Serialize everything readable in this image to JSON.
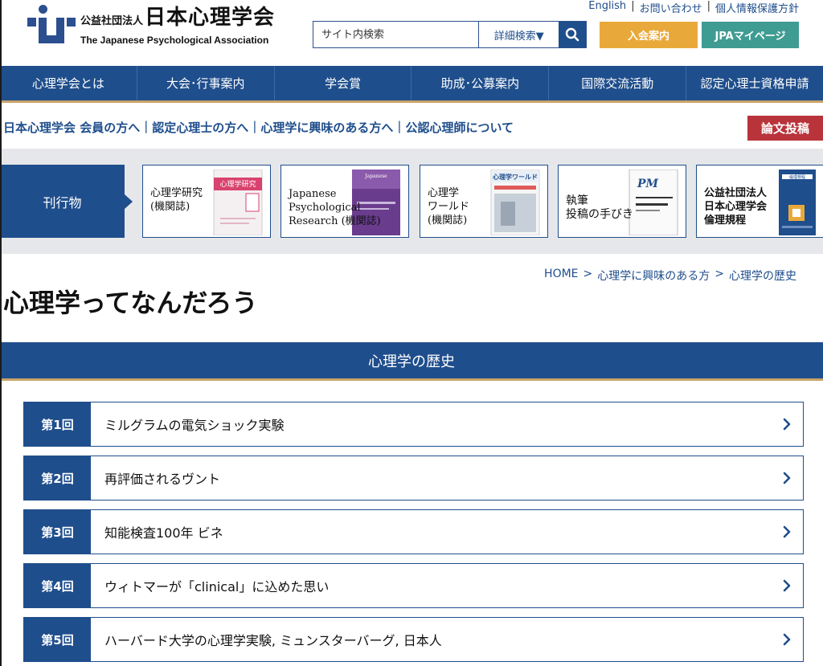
{
  "header": {
    "logo": {
      "jp_small": "公益社団法人",
      "jp_big": "日本心理学会",
      "en": "The Japanese Psychological Association"
    },
    "toplinks": [
      "English",
      "お問い合わせ",
      "個人情報保護方針"
    ],
    "search": {
      "placeholder": "サイト内検索",
      "advanced_label": "詳細検索▼"
    },
    "join_label": "入会案内",
    "mypage_label": "JPAマイページ"
  },
  "nav": {
    "items": [
      "心理学会とは",
      "大会･行事案内",
      "学会賞",
      "助成･公募案内",
      "国際交流活動",
      "認定心理士資格申請"
    ]
  },
  "audience": {
    "links": [
      "日本心理学会 会員の方へ",
      "認定心理士の方へ",
      "心理学に興味のある方へ",
      "公認心理師について"
    ],
    "submit_label": "論文投稿"
  },
  "publications": {
    "label": "刊行物",
    "cards": [
      {
        "text": "心理学研究\n(機関誌)",
        "cover_text": "心理学研究"
      },
      {
        "text": "Japanese\nPsychological\nResearch (機関誌)",
        "cover_text": "Japanese Psychological Research"
      },
      {
        "text": "心理学\nワールド\n(機関誌)",
        "cover_text": "心理学ワールド"
      },
      {
        "text": "執筆\n投稿の手びき",
        "cover_text": "執筆・投稿の手びき"
      },
      {
        "text": "公益社団法人\n日本心理学会\n倫理規程",
        "cover_text": "倫理規程"
      }
    ]
  },
  "breadcrumb": [
    "HOME",
    ">",
    "心理学に興味のある方",
    ">",
    "心理学の歴史"
  ],
  "page_title": "心理学ってなんだろう",
  "section_title": "心理学の歴史",
  "articles": [
    {
      "num": "第1回",
      "title": "ミルグラムの電気ショック実験"
    },
    {
      "num": "第2回",
      "title": "再評価されるヴント"
    },
    {
      "num": "第3回",
      "title": "知能検査100年 ビネ"
    },
    {
      "num": "第4回",
      "title": "ウィトマーが「clinical」に込めた思い"
    },
    {
      "num": "第5回",
      "title": "ハーバード大学の心理学実験, ミュンスターバーグ, 日本人"
    }
  ],
  "colors": {
    "navy": "#1f4e8c",
    "gold": "#c7a36a",
    "orange": "#e9a93a",
    "teal": "#3f9c92",
    "red": "#b8343a"
  }
}
